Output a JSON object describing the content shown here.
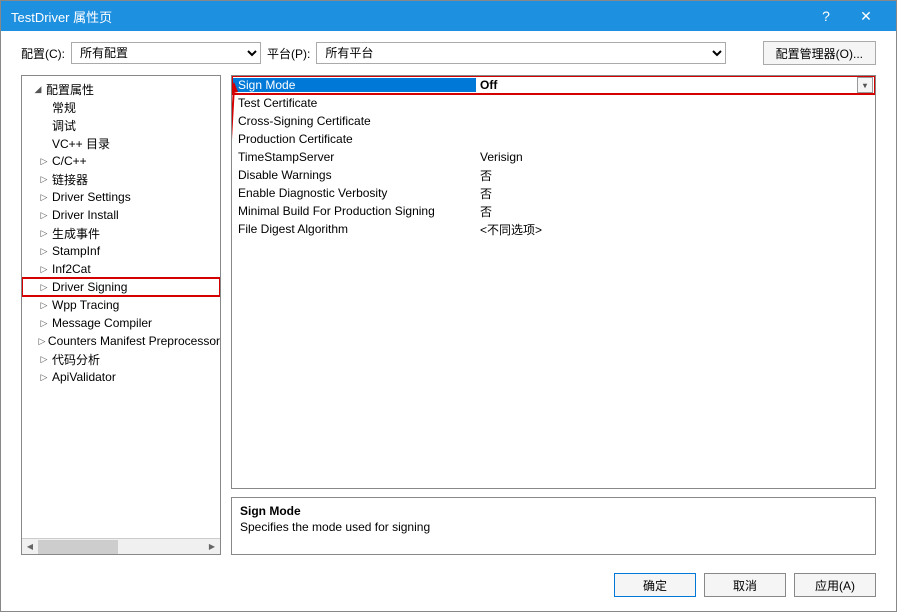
{
  "window": {
    "title": "TestDriver 属性页",
    "help": "?",
    "close": "✕"
  },
  "toolbar": {
    "config_label": "配置(C):",
    "config_value": "所有配置",
    "platform_label": "平台(P):",
    "platform_value": "所有平台",
    "cfgmgr_label": "配置管理器(O)..."
  },
  "tree": {
    "root": "配置属性",
    "items": [
      {
        "label": "常规",
        "leaf": true
      },
      {
        "label": "调试",
        "leaf": true
      },
      {
        "label": "VC++ 目录",
        "leaf": true
      },
      {
        "label": "C/C++",
        "leaf": false
      },
      {
        "label": "链接器",
        "leaf": false
      },
      {
        "label": "Driver Settings",
        "leaf": false
      },
      {
        "label": "Driver Install",
        "leaf": false
      },
      {
        "label": "生成事件",
        "leaf": false
      },
      {
        "label": "StampInf",
        "leaf": false
      },
      {
        "label": "Inf2Cat",
        "leaf": false
      },
      {
        "label": "Driver Signing",
        "leaf": false,
        "highlight": true
      },
      {
        "label": "Wpp Tracing",
        "leaf": false
      },
      {
        "label": "Message Compiler",
        "leaf": false
      },
      {
        "label": "Counters Manifest Preprocessor",
        "leaf": false
      },
      {
        "label": "代码分析",
        "leaf": false
      },
      {
        "label": "ApiValidator",
        "leaf": false
      }
    ]
  },
  "props": [
    {
      "name": "Sign Mode",
      "value": "Off",
      "selected": true
    },
    {
      "name": "Test Certificate",
      "value": ""
    },
    {
      "name": "Cross-Signing Certificate",
      "value": ""
    },
    {
      "name": "Production Certificate",
      "value": ""
    },
    {
      "name": "TimeStampServer",
      "value": "Verisign"
    },
    {
      "name": "Disable Warnings",
      "value": "否"
    },
    {
      "name": "Enable Diagnostic Verbosity",
      "value": "否"
    },
    {
      "name": "Minimal Build For Production Signing",
      "value": "否"
    },
    {
      "name": "File Digest Algorithm",
      "value": "<不同选项>"
    }
  ],
  "desc": {
    "title": "Sign Mode",
    "text": "Specifies the mode used for signing"
  },
  "footer": {
    "ok": "确定",
    "cancel": "取消",
    "apply": "应用(A)"
  }
}
